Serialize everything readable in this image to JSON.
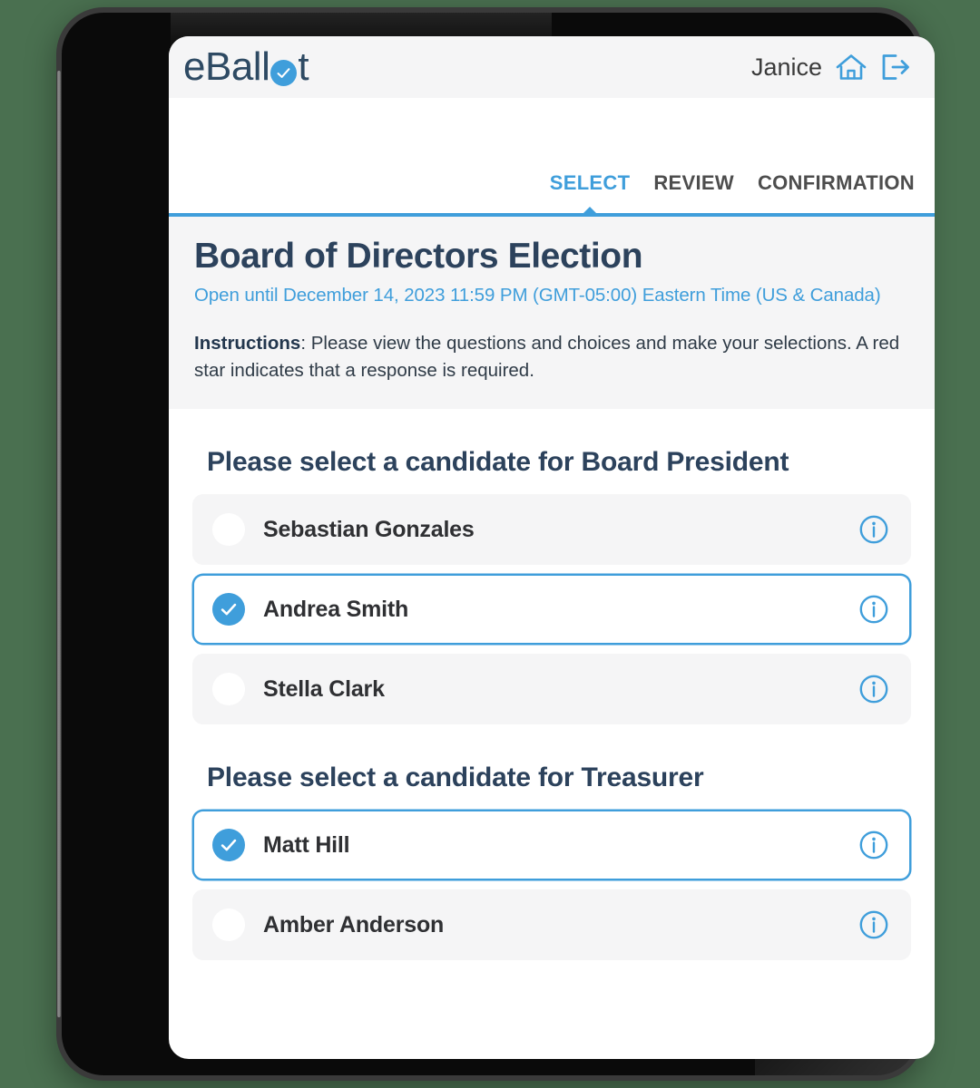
{
  "device": {
    "frame": "tablet"
  },
  "theme": {
    "accent": "#3f9edb",
    "title_navy": "#2c425c",
    "page_background": "#4a7050",
    "panel_gray": "#f5f5f6"
  },
  "header": {
    "logo_text_before": "eBall",
    "logo_badge_icon": "check-badge-icon",
    "logo_text_after": "t",
    "user_name": "Janice",
    "home_icon": "home-icon",
    "logout_icon": "logout-icon"
  },
  "tabs": [
    {
      "label": "SELECT",
      "active": true
    },
    {
      "label": "REVIEW",
      "active": false
    },
    {
      "label": "CONFIRMATION",
      "active": false
    }
  ],
  "ballot": {
    "title": "Board of Directors Election",
    "subtitle": "Open until December 14, 2023 11:59 PM (GMT-05:00) Eastern Time (US & Canada)",
    "instructions_label": "Instructions",
    "instructions_text": ": Please view the questions and choices and make your selections. A red star indicates that a response is required."
  },
  "questions": [
    {
      "title": "Please select a candidate for Board President",
      "options": [
        {
          "name": "Sebastian Gonzales",
          "selected": false,
          "info_icon": "info-icon"
        },
        {
          "name": "Andrea Smith",
          "selected": true,
          "info_icon": "info-icon"
        },
        {
          "name": "Stella Clark",
          "selected": false,
          "info_icon": "info-icon"
        }
      ]
    },
    {
      "title": "Please select a candidate for Treasurer",
      "options": [
        {
          "name": "Matt Hill",
          "selected": true,
          "info_icon": "info-icon"
        },
        {
          "name": "Amber Anderson",
          "selected": false,
          "info_icon": "info-icon"
        }
      ]
    }
  ]
}
